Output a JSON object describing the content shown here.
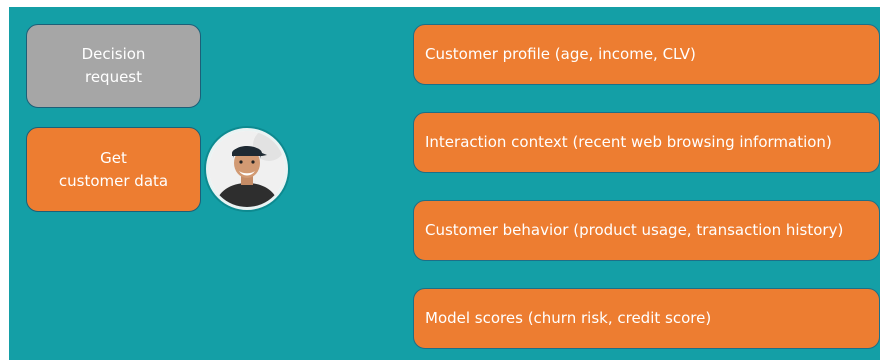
{
  "left": {
    "decision_request": {
      "line1": "Decision",
      "line2": "request"
    },
    "get_customer_data": {
      "line1": "Get",
      "line2": "customer data"
    }
  },
  "right": {
    "items": [
      {
        "label": "Customer profile (age, income, CLV)"
      },
      {
        "label": "Interaction context (recent web browsing information)"
      },
      {
        "label": "Customer behavior (product usage, transaction history)"
      },
      {
        "label": "Model scores (churn risk, credit score)"
      }
    ]
  },
  "colors": {
    "background": "#149fa6",
    "orange": "#ed7d31",
    "gray": "#a6a6a6"
  },
  "icons": {
    "avatar": "customer-avatar-photo"
  }
}
